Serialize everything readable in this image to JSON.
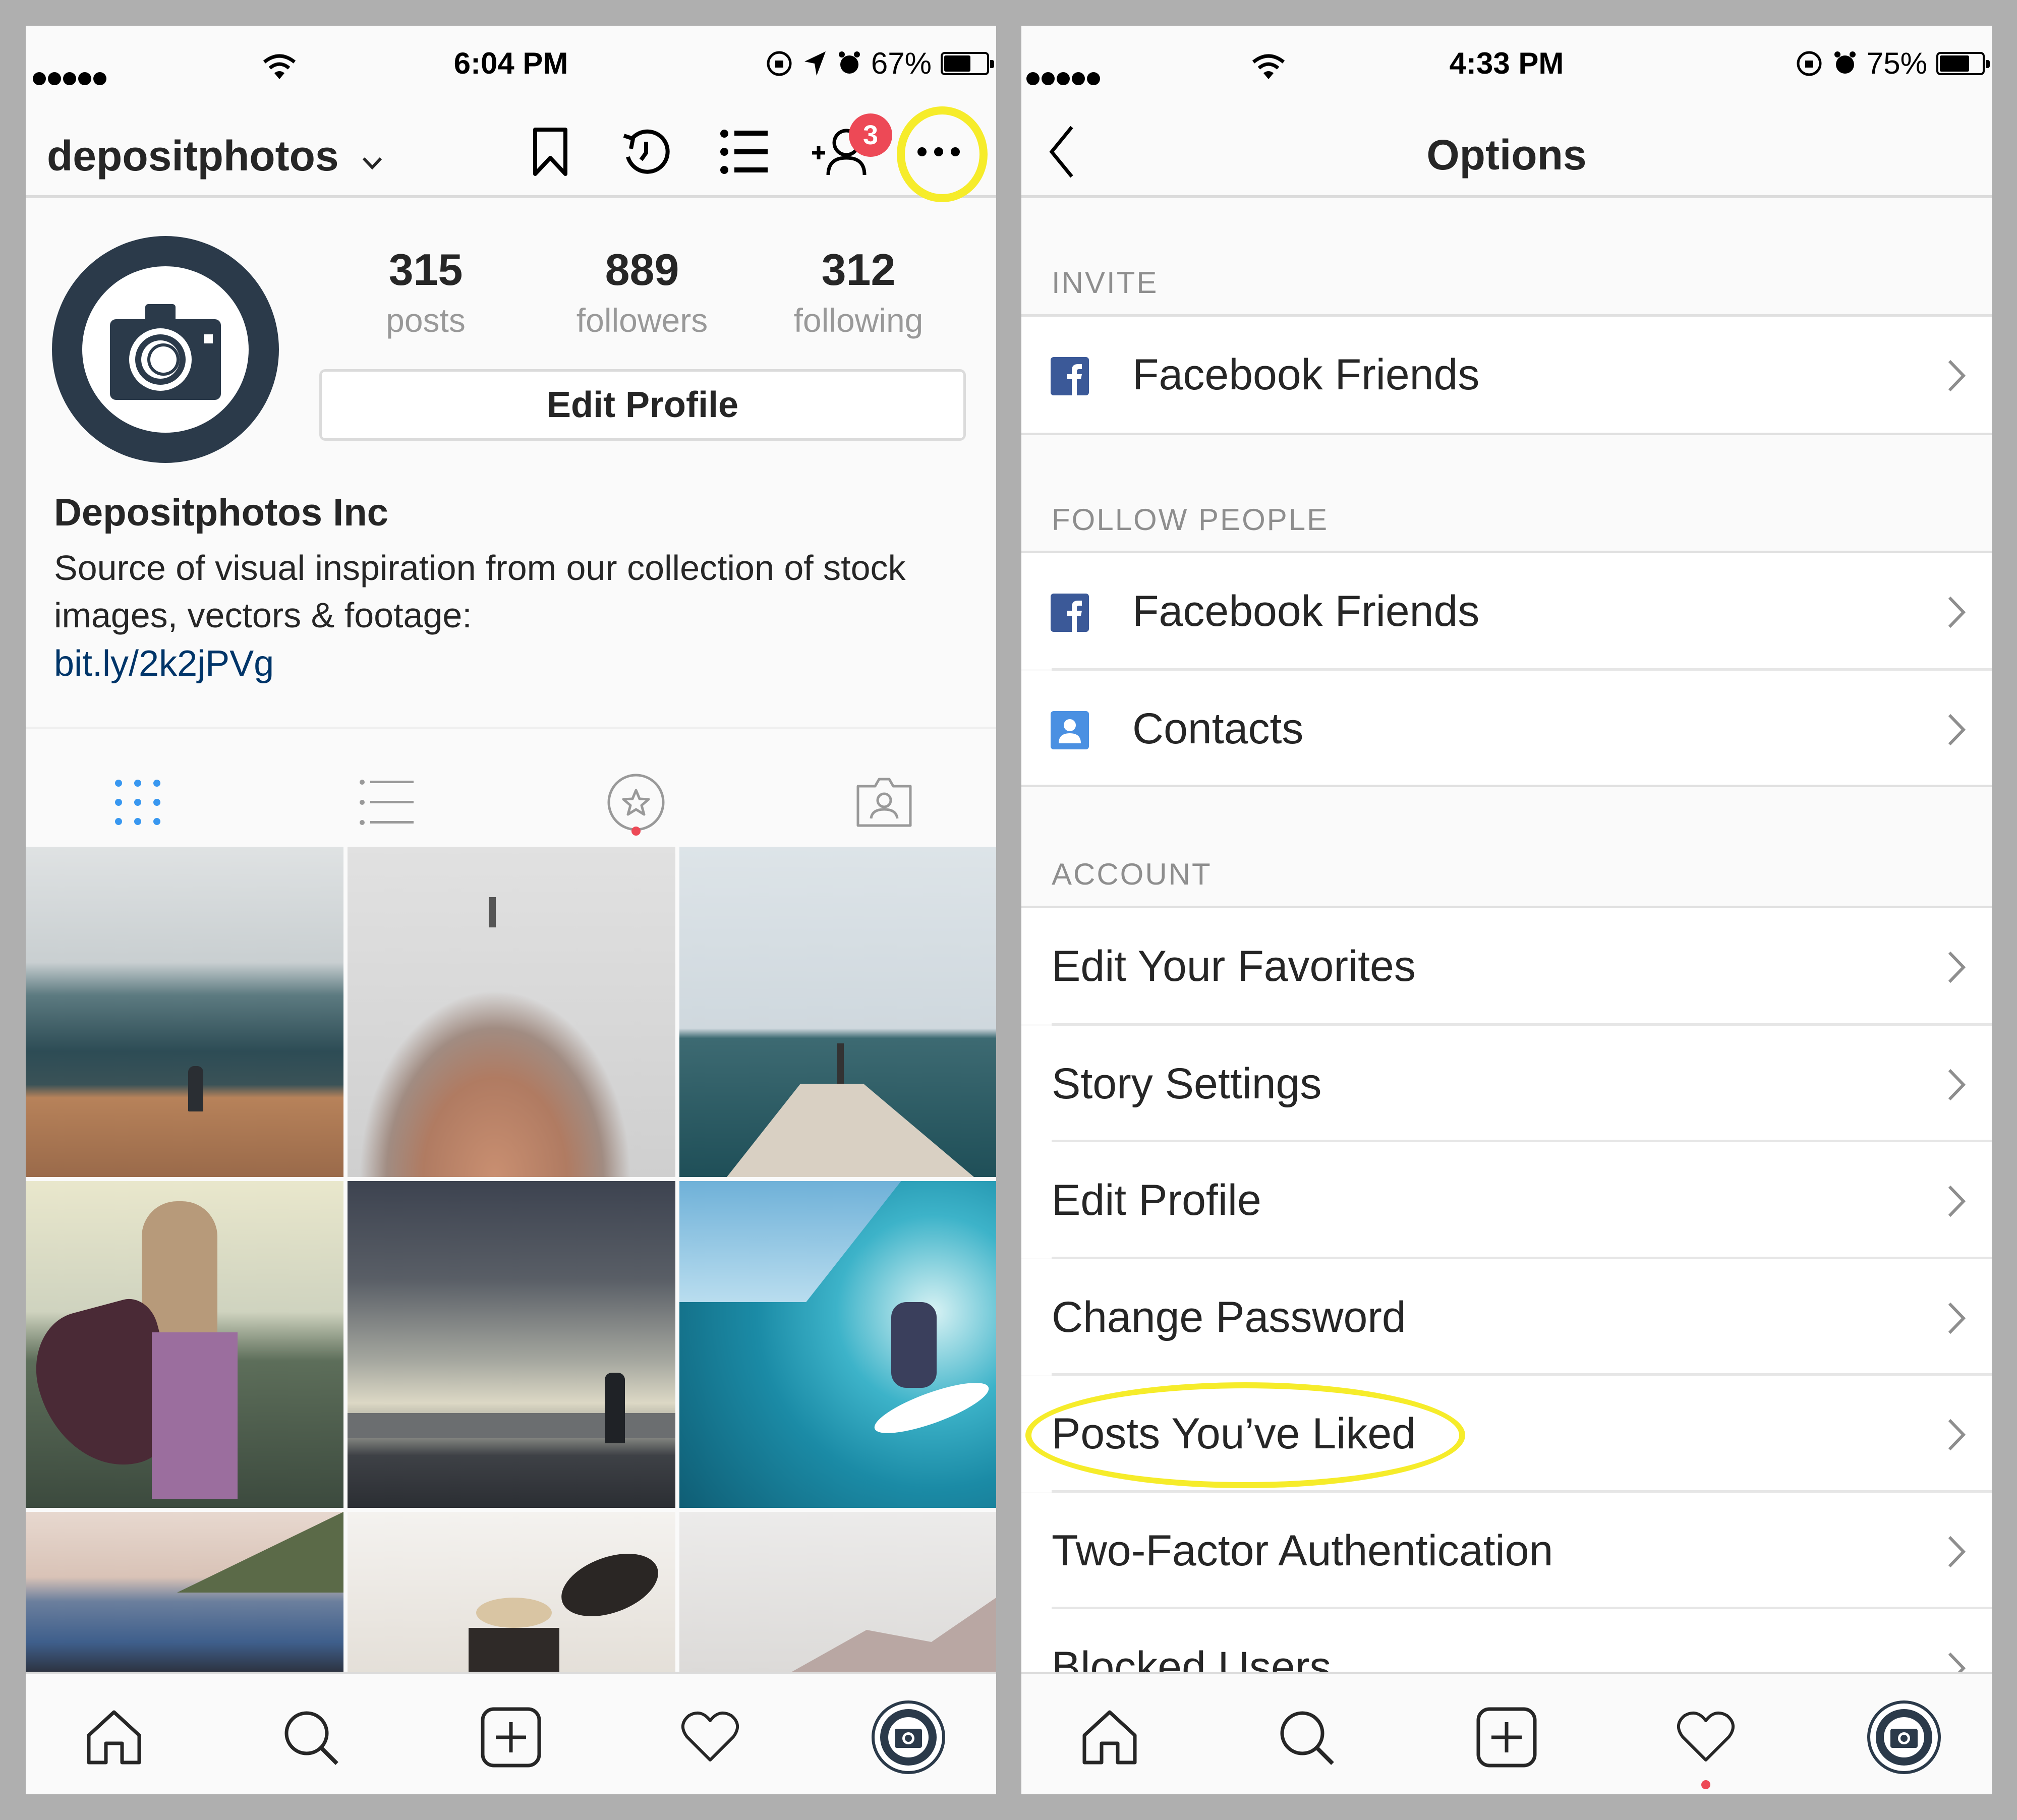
{
  "colors": {
    "background": "#afafaf",
    "highlight": "#f6ec2a",
    "badge": "#ed4956",
    "link": "#003569",
    "active_tab": "#3897f0",
    "facebook": "#3b5998",
    "contacts": "#4a90e2"
  },
  "left_screen": {
    "status_bar": {
      "signal_icon": "signal-dots-icon",
      "wifi_icon": "wifi-icon",
      "time": "6:04 PM",
      "indicators": [
        "rotation-lock-icon",
        "location-arrow-icon",
        "alarm-icon"
      ],
      "battery_text": "67%",
      "battery_level": 0.67
    },
    "header": {
      "username": "depositphotos",
      "dropdown_icon": "chevron-down-icon",
      "icons": [
        "bookmark-icon",
        "archive-history-icon",
        "list-icon",
        "add-person-icon",
        "more-icon"
      ],
      "notification_badge": "3"
    },
    "profile": {
      "avatar_icon": "camera-logo-icon",
      "stats": [
        {
          "value": "315",
          "label": "posts"
        },
        {
          "value": "889",
          "label": "followers"
        },
        {
          "value": "312",
          "label": "following"
        }
      ],
      "edit_button": "Edit Profile",
      "name": "Depositphotos Inc",
      "bio": "Source of visual inspiration from our collection of stock images, vectors & footage:",
      "link": "bit.ly/2k2jPVg"
    },
    "profile_tabs": [
      {
        "icon": "grid-icon",
        "active": true
      },
      {
        "icon": "list-view-icon",
        "active": false
      },
      {
        "icon": "star-circle-icon",
        "active": false,
        "dot": true
      },
      {
        "icon": "tagged-photos-icon",
        "active": false
      }
    ],
    "photos": [
      {
        "subject": "person on hillside above misty mountains"
      },
      {
        "subject": "person atop foggy rocky peak"
      },
      {
        "subject": "person at end of pier over sea"
      },
      {
        "subject": "woman with long hair in patterned cloak"
      },
      {
        "subject": "person by railing under stormy sky"
      },
      {
        "subject": "surfer riding a wave"
      },
      {
        "subject": "blue town on hillside"
      },
      {
        "subject": "person in straw hat with birds"
      },
      {
        "subject": "misty mountains"
      }
    ],
    "tab_bar": [
      "home-icon",
      "search-icon",
      "add-post-icon",
      "heart-icon",
      "profile-avatar-icon"
    ]
  },
  "right_screen": {
    "status_bar": {
      "signal_icon": "signal-dots-icon",
      "wifi_icon": "wifi-icon",
      "time": "4:33 PM",
      "indicators": [
        "rotation-lock-icon",
        "alarm-icon"
      ],
      "battery_text": "75%",
      "battery_level": 0.75
    },
    "header": {
      "back_icon": "chevron-left-icon",
      "title": "Options"
    },
    "sections": [
      {
        "title": "INVITE",
        "items": [
          {
            "label": "Facebook Friends",
            "icon": "facebook-icon"
          }
        ]
      },
      {
        "title": "FOLLOW PEOPLE",
        "items": [
          {
            "label": "Facebook Friends",
            "icon": "facebook-icon"
          },
          {
            "label": "Contacts",
            "icon": "contacts-icon"
          }
        ]
      },
      {
        "title": "ACCOUNT",
        "items": [
          {
            "label": "Edit Your Favorites"
          },
          {
            "label": "Story Settings"
          },
          {
            "label": "Edit Profile"
          },
          {
            "label": "Change Password"
          },
          {
            "label": "Posts You’ve Liked",
            "highlighted": true
          },
          {
            "label": "Two-Factor Authentication"
          },
          {
            "label": "Blocked Users"
          }
        ]
      }
    ],
    "tab_bar": [
      "home-icon",
      "search-icon",
      "add-post-icon",
      "heart-icon",
      "profile-avatar-icon"
    ],
    "activity_dot_on": "heart-icon"
  }
}
